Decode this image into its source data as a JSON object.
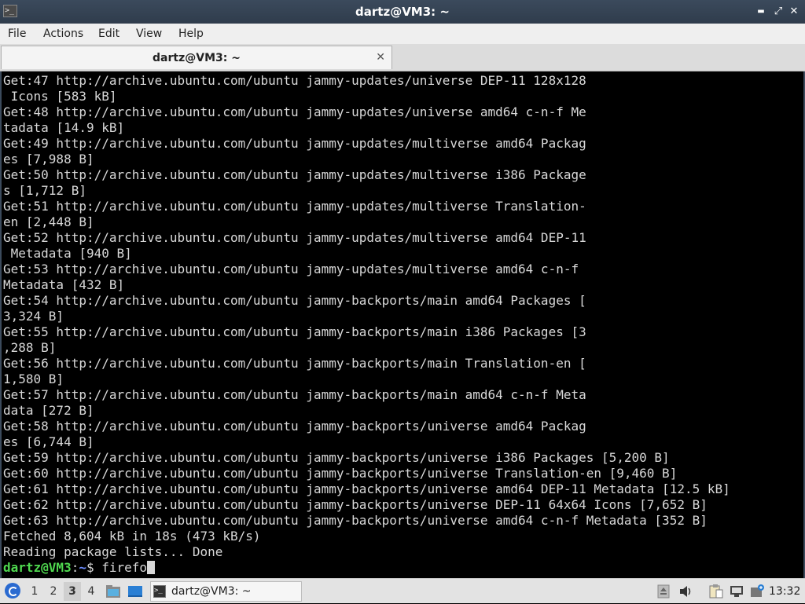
{
  "window": {
    "title": "dartz@VM3: ~",
    "controls": {
      "minimize": "▬",
      "maximize": "⤢",
      "close": "✕"
    }
  },
  "menubar": {
    "items": [
      "File",
      "Actions",
      "Edit",
      "View",
      "Help"
    ]
  },
  "tabs": [
    {
      "label": "dartz@VM3: ~",
      "close": "✕"
    }
  ],
  "terminal": {
    "lines": [
      "Get:47 http://archive.ubuntu.com/ubuntu jammy-updates/universe DEP-11 128x128",
      " Icons [583 kB]",
      "Get:48 http://archive.ubuntu.com/ubuntu jammy-updates/universe amd64 c-n-f Me",
      "tadata [14.9 kB]",
      "Get:49 http://archive.ubuntu.com/ubuntu jammy-updates/multiverse amd64 Packag",
      "es [7,988 B]",
      "Get:50 http://archive.ubuntu.com/ubuntu jammy-updates/multiverse i386 Package",
      "s [1,712 B]",
      "Get:51 http://archive.ubuntu.com/ubuntu jammy-updates/multiverse Translation-",
      "en [2,448 B]",
      "Get:52 http://archive.ubuntu.com/ubuntu jammy-updates/multiverse amd64 DEP-11",
      " Metadata [940 B]",
      "Get:53 http://archive.ubuntu.com/ubuntu jammy-updates/multiverse amd64 c-n-f",
      "Metadata [432 B]",
      "Get:54 http://archive.ubuntu.com/ubuntu jammy-backports/main amd64 Packages [",
      "3,324 B]",
      "Get:55 http://archive.ubuntu.com/ubuntu jammy-backports/main i386 Packages [3",
      ",288 B]",
      "Get:56 http://archive.ubuntu.com/ubuntu jammy-backports/main Translation-en [",
      "1,580 B]",
      "Get:57 http://archive.ubuntu.com/ubuntu jammy-backports/main amd64 c-n-f Meta",
      "data [272 B]",
      "Get:58 http://archive.ubuntu.com/ubuntu jammy-backports/universe amd64 Packag",
      "es [6,744 B]",
      "Get:59 http://archive.ubuntu.com/ubuntu jammy-backports/universe i386 Packages [5,200 B]",
      "Get:60 http://archive.ubuntu.com/ubuntu jammy-backports/universe Translation-en [9,460 B]",
      "Get:61 http://archive.ubuntu.com/ubuntu jammy-backports/universe amd64 DEP-11 Metadata [12.5 kB]",
      "Get:62 http://archive.ubuntu.com/ubuntu jammy-backports/universe DEP-11 64x64 Icons [7,652 B]",
      "Get:63 http://archive.ubuntu.com/ubuntu jammy-backports/universe amd64 c-n-f Metadata [352 B]",
      "Fetched 8,604 kB in 18s (473 kB/s)",
      "Reading package lists... Done"
    ],
    "prompt": {
      "user_host": "dartz@VM3",
      "separator": ":",
      "path": "~",
      "symbol": "$ ",
      "input": "firefo"
    }
  },
  "taskbar": {
    "workspaces": [
      "1",
      "2",
      "3",
      "4"
    ],
    "active_workspace": "3",
    "task_label": "dartz@VM3: ~",
    "clock": "13:32",
    "icons": [
      "start-menu-icon",
      "file-manager-icon",
      "show-desktop-icon",
      "terminal-icon",
      "eject-icon",
      "volume-icon",
      "clipboard-icon",
      "network-icon",
      "update-notifier-icon"
    ]
  },
  "colors": {
    "prompt_user": "#4fd84f",
    "prompt_path": "#6c8cff",
    "terminal_bg": "#000000",
    "terminal_fg": "#d8d8d8",
    "titlebar": "#3b4a5c"
  }
}
